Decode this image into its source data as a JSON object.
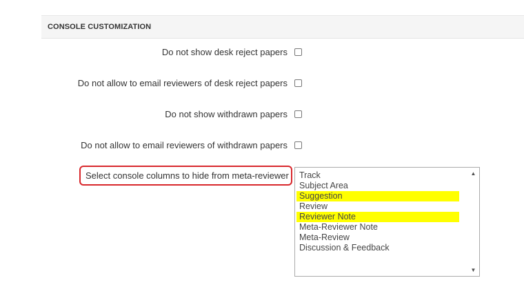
{
  "section": {
    "title": "CONSOLE CUSTOMIZATION"
  },
  "options": [
    {
      "label": "Do not show desk reject papers",
      "checked": false
    },
    {
      "label": "Do not allow to email reviewers of desk reject papers",
      "checked": false
    },
    {
      "label": "Do not show withdrawn papers",
      "checked": false
    },
    {
      "label": "Do not allow to email reviewers of withdrawn papers",
      "checked": false
    }
  ],
  "hide_columns": {
    "label": "Select console columns to hide from meta-reviewer",
    "items": [
      {
        "label": "Track",
        "selected": false
      },
      {
        "label": "Subject Area",
        "selected": false
      },
      {
        "label": "Suggestion",
        "selected": true
      },
      {
        "label": "Review",
        "selected": false
      },
      {
        "label": "Reviewer Note",
        "selected": true
      },
      {
        "label": "Meta-Reviewer Note",
        "selected": false
      },
      {
        "label": "Meta-Review",
        "selected": false
      },
      {
        "label": "Discussion & Feedback",
        "selected": false
      }
    ]
  },
  "colors": {
    "selection_highlight": "#ffff00",
    "callout_border": "#d8262b"
  }
}
